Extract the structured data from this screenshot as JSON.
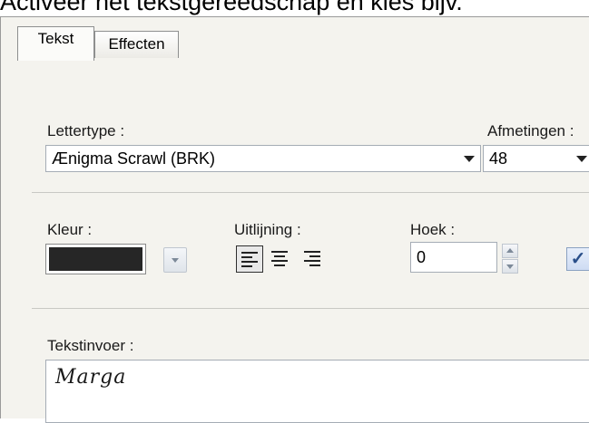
{
  "caption": "Activeer het tekstgereedschap en kies bijv.",
  "tabs": [
    {
      "label": "Tekst",
      "active": true
    },
    {
      "label": "Effecten",
      "active": false
    }
  ],
  "font": {
    "label": "Lettertype :",
    "value": "Ænigma Scrawl (BRK)"
  },
  "size": {
    "label": "Afmetingen :",
    "value": "48"
  },
  "color": {
    "label": "Kleur :",
    "swatch": "#262626"
  },
  "alignment": {
    "label": "Uitlijning :",
    "options": [
      "left",
      "center",
      "right"
    ],
    "selected": "left"
  },
  "angle": {
    "label": "Hoek :",
    "value": "0"
  },
  "checkbox_checked": true,
  "text_input": {
    "label": "Tekstinvoer :",
    "value": "Marga"
  }
}
